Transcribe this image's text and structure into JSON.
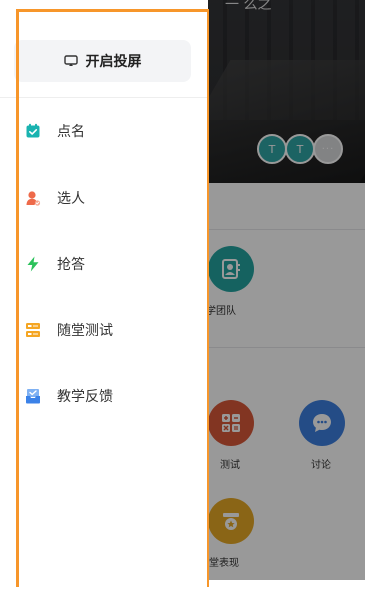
{
  "hero": {
    "title_fragment": "一 么之",
    "avatars": [
      "T",
      "T"
    ],
    "more_avatars": "···"
  },
  "background_apps": [
    {
      "label": "教学团队",
      "icon": "team-icon",
      "color": "#23a4a1"
    },
    {
      "label": "测试",
      "icon": "test-icon",
      "color": "#d9593a"
    },
    {
      "label": "讨论",
      "icon": "discussion-icon",
      "color": "#3d7fe0"
    },
    {
      "label": "课堂表现",
      "icon": "performance-icon",
      "color": "#e6a826"
    }
  ],
  "drawer": {
    "cast_button": {
      "label": "开启投屏",
      "icon": "cast-screen-icon"
    },
    "items": [
      {
        "label": "点名",
        "icon": "roll-call-icon",
        "color": "#19b3b0"
      },
      {
        "label": "选人",
        "icon": "pick-person-icon",
        "color": "#ee6a4a"
      },
      {
        "label": "抢答",
        "icon": "lightning-icon",
        "color": "#2cc25b"
      },
      {
        "label": "随堂测试",
        "icon": "quiz-icon",
        "color": "#f5a623"
      },
      {
        "label": "教学反馈",
        "icon": "feedback-icon",
        "color": "#3b82e8"
      }
    ]
  },
  "colors": {
    "highlight_border": "#f7962a",
    "overlay": "rgba(0,0,0,0.40)"
  }
}
